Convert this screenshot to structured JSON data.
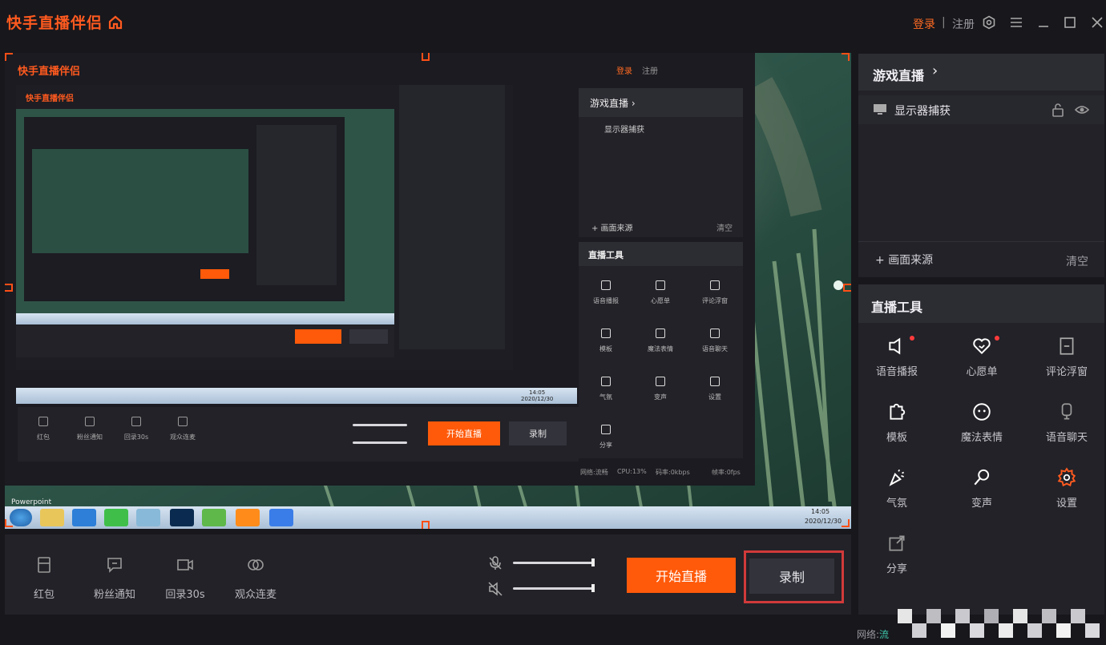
{
  "app": {
    "title": "快手直播伴侣"
  },
  "titlebar": {
    "login": "登录",
    "separator": "|",
    "register": "注册"
  },
  "right_panel": {
    "game_live": {
      "title": "游戏直播",
      "chevron": "›"
    },
    "sources": [
      {
        "label": "显示器捕获"
      }
    ],
    "add_source": "画面来源",
    "clear": "清空",
    "tools_title": "直播工具",
    "tools": [
      {
        "label": "语音播报",
        "icon": "speaker-icon",
        "dot": true
      },
      {
        "label": "心愿单",
        "icon": "heart-icon",
        "dot": true
      },
      {
        "label": "评论浮窗",
        "icon": "comment-window-icon",
        "dot": false
      },
      {
        "label": "模板",
        "icon": "puzzle-icon",
        "dot": false
      },
      {
        "label": "魔法表情",
        "icon": "magic-face-icon",
        "dot": false
      },
      {
        "label": "语音聊天",
        "icon": "mic-icon",
        "dot": false
      },
      {
        "label": "气氛",
        "icon": "party-icon",
        "dot": false
      },
      {
        "label": "变声",
        "icon": "voice-change-icon",
        "dot": false
      },
      {
        "label": "设置",
        "icon": "settings-gear-icon",
        "dot": false
      },
      {
        "label": "分享",
        "icon": "share-icon",
        "dot": false
      }
    ]
  },
  "bottom_bar": {
    "tools": [
      {
        "label": "红包",
        "icon": "red-envelope-icon"
      },
      {
        "label": "粉丝通知",
        "icon": "fan-notify-icon"
      },
      {
        "label": "回录30s",
        "icon": "video-camera-icon"
      },
      {
        "label": "观众连麦",
        "icon": "link-mic-icon"
      }
    ],
    "start_live": "开始直播",
    "record": "录制"
  },
  "status": {
    "network_label": "网络:",
    "network_value": "流"
  },
  "preview": {
    "nested_window": {
      "title": "快手直播伴侣",
      "login": "登录",
      "register": "注册",
      "game_live": "游戏直播 ›",
      "source": "显示器捕获",
      "add_source": "+ 画面来源",
      "clear": "清空",
      "tools_title": "直播工具",
      "tools": [
        "语音播报",
        "心愿单",
        "评论浮窗",
        "模板",
        "魔法表情",
        "语音聊天",
        "气氛",
        "变声",
        "设置",
        "分享"
      ],
      "bottom_tools": [
        "红包",
        "粉丝通知",
        "回录30s",
        "观众连麦"
      ],
      "start_live": "开始直播",
      "record": "录制",
      "status": [
        "网络:流畅",
        "CPU:13%",
        "码率:0kbps",
        "帧率:0fps"
      ]
    },
    "taskbar": {
      "label": "Powerpoint",
      "time": "14:05",
      "date": "2020/12/30"
    }
  },
  "colors": {
    "accent": "#ff5a0a",
    "brand": "#ff5a1f",
    "highlight": "#d13a3a",
    "panel": "#222228"
  }
}
